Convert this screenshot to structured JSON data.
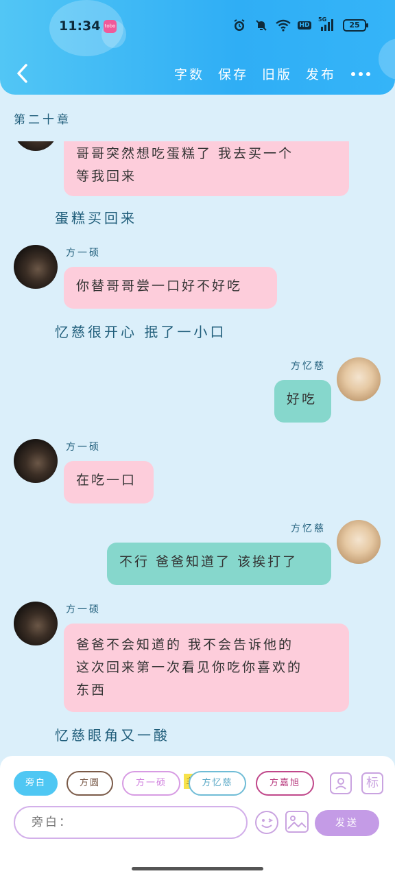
{
  "status": {
    "time": "11:34",
    "app_badge": "tobo",
    "battery": "25",
    "net": "HD",
    "net_gen": "5G"
  },
  "header": {
    "actions": [
      "字数",
      "保存",
      "旧版",
      "发布"
    ]
  },
  "chapter_title": "第二十章",
  "messages": [
    {
      "type": "bubble",
      "speaker": "",
      "text_lines": [
        "哥哥突然想吃蛋糕了 我去买一个",
        "等我回来"
      ]
    },
    {
      "type": "narration",
      "text": "蛋糕买回来"
    },
    {
      "type": "bubble",
      "speaker": "方一硕",
      "text_lines": [
        "你替哥哥尝一口好不好吃"
      ]
    },
    {
      "type": "narration",
      "text": "忆慈很开心 抿了一小口"
    },
    {
      "type": "bubble",
      "speaker": "方忆慈",
      "text_lines": [
        "好吃"
      ]
    },
    {
      "type": "bubble",
      "speaker": "方一硕",
      "text_lines": [
        "在吃一口"
      ]
    },
    {
      "type": "bubble",
      "speaker": "方忆慈",
      "text_lines": [
        "不行 爸爸知道了 该挨打了"
      ]
    },
    {
      "type": "bubble",
      "speaker": "方一硕",
      "text_lines": [
        "爸爸不会知道的 我不会告诉他的",
        "这次回来第一次看见你吃你喜欢的",
        "东西"
      ]
    },
    {
      "type": "narration",
      "text": "忆慈眼角又一酸"
    }
  ],
  "composer": {
    "chips": [
      "旁白",
      "方圆",
      "方一硕",
      "方忆慈",
      "方嘉旭"
    ],
    "main_tag": "主",
    "mark_btn": "标",
    "placeholder": "旁白：",
    "send_label": "发送"
  },
  "colors": {
    "header": "#35b4f8",
    "background": "#dbeffa",
    "bubble_other": "#fdcddb",
    "bubble_self": "#86d7cc",
    "send": "#c49be6"
  }
}
